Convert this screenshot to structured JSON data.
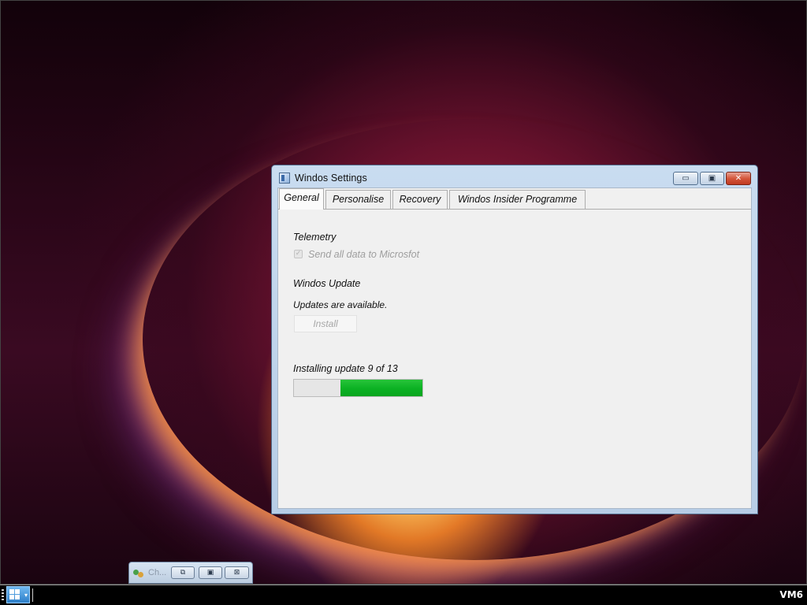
{
  "window": {
    "title": "Windos Settings",
    "controls": {
      "minimize": "▭",
      "maximize": "▣",
      "close": "✕"
    }
  },
  "tabs": [
    {
      "label": "General",
      "active": true
    },
    {
      "label": "Personalise",
      "active": false
    },
    {
      "label": "Recovery",
      "active": false
    },
    {
      "label": "Windos Insider Programme",
      "active": false
    }
  ],
  "general": {
    "telemetry_heading": "Telemetry",
    "telemetry_checkbox": {
      "label": "Send all data to Microsfot",
      "checked": true,
      "disabled": true
    },
    "update_heading": "Windos Update",
    "updates_status": "Updates are available.",
    "install_button": {
      "label": "Install",
      "disabled": true
    },
    "progress": {
      "label": "Installing update 9 of 13",
      "fill_fraction_start": 0.36,
      "fill_fraction_end": 1.0,
      "color": "#0bb123"
    }
  },
  "minimized_window": {
    "title": "Ch...",
    "buttons": {
      "restore": "⧉",
      "maximize": "▣",
      "close": "⊠"
    }
  },
  "taskbar": {
    "vm_label": "VM6",
    "start_color": "#2d7ec8"
  }
}
